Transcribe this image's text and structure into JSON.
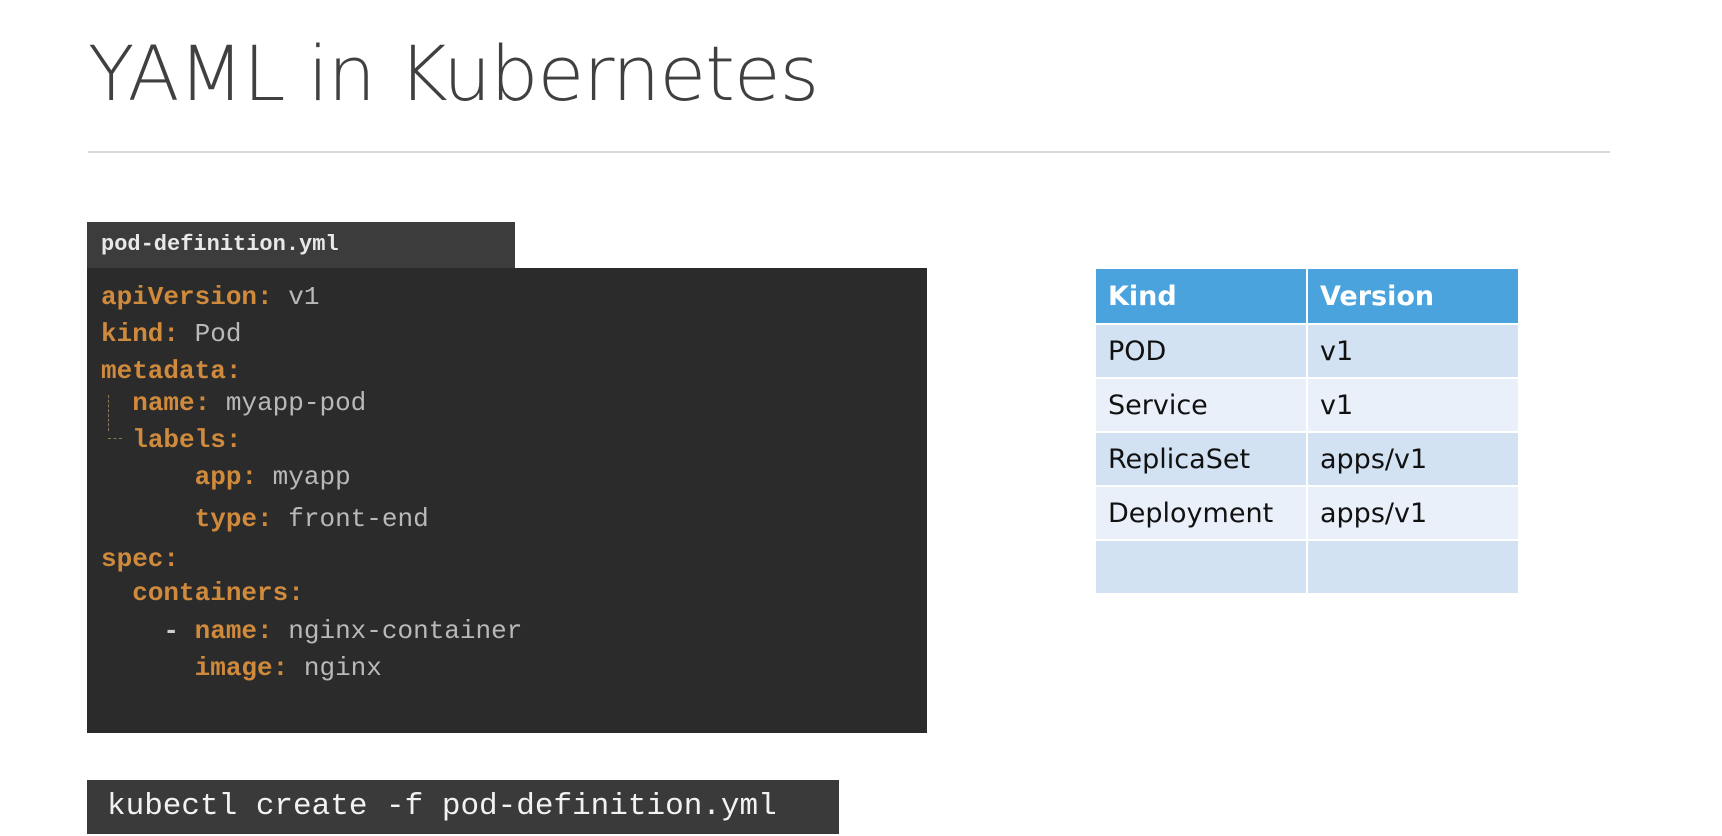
{
  "slide": {
    "title": "YAML in Kubernetes"
  },
  "code_file": {
    "filename": "pod-definition.yml",
    "lines": [
      {
        "indent": "",
        "key": "apiVersion",
        "value": "v1"
      },
      {
        "indent": "",
        "key": "kind",
        "value": "Pod"
      },
      {
        "indent": "",
        "key": "metadata",
        "value": ""
      },
      {
        "indent": "  ",
        "key": "name",
        "value": "myapp-pod"
      },
      {
        "indent": "  ",
        "key": "labels",
        "value": ""
      },
      {
        "indent": "      ",
        "key": "app",
        "value": "myapp"
      },
      {
        "indent": "      ",
        "key": "type",
        "value": "front-end"
      },
      {
        "indent": "",
        "key": "spec",
        "value": ""
      },
      {
        "indent": "  ",
        "key": "containers",
        "value": ""
      },
      {
        "indent": "    - ",
        "key": "name",
        "value": "nginx-container"
      },
      {
        "indent": "      ",
        "key": "image",
        "value": "nginx"
      }
    ]
  },
  "command": {
    "text": "kubectl create -f pod-definition.yml"
  },
  "table": {
    "headers": [
      "Kind",
      "Version"
    ],
    "rows": [
      [
        "POD",
        "v1"
      ],
      [
        "Service",
        "v1"
      ],
      [
        "ReplicaSet",
        "apps/v1"
      ],
      [
        "Deployment",
        "apps/v1"
      ],
      [
        "",
        ""
      ]
    ]
  },
  "colors": {
    "code_background": "#2b2b2b",
    "yaml_key": "#cf8a3c",
    "yaml_value": "#b9b9b9",
    "table_header": "#4aa3dc",
    "table_row_dark": "#d2e2f3",
    "table_row_light": "#e9f0f9"
  }
}
